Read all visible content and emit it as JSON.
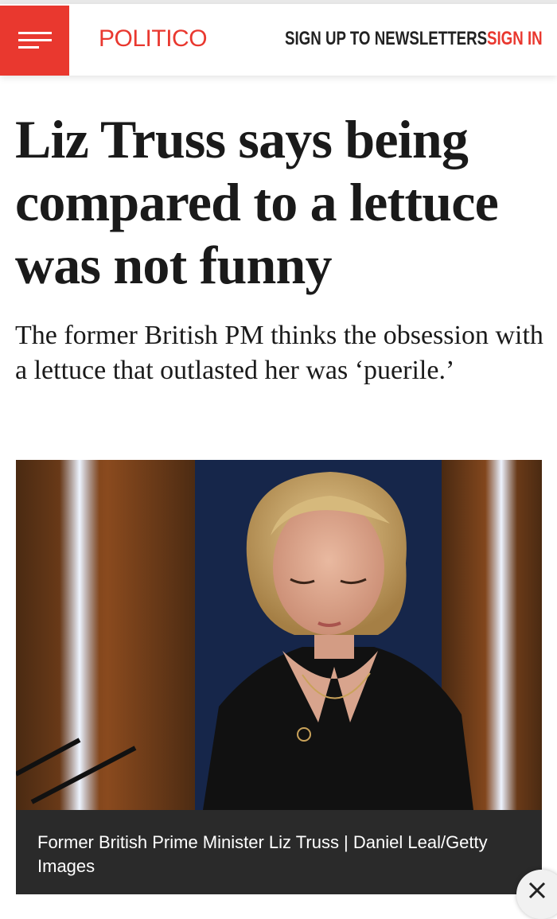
{
  "header": {
    "logo": "POLITICO",
    "newsletters_label": "SIGN UP TO NEWSLETTERS",
    "signin_label": "SIGN IN",
    "menu_icon": "hamburger-menu-icon"
  },
  "article": {
    "headline": "Liz Truss says being compared to a lettuce was not funny",
    "dek": "The former British PM thinks the obsession with a lettuce that outlasted her was ‘puerile.’",
    "caption": "Former British Prime Minister Liz Truss | Daniel Leal/Getty Images"
  },
  "overlay": {
    "close_icon": "close-icon"
  },
  "colors": {
    "brand_red": "#e9382f",
    "text_dark": "#1a1a1a",
    "caption_bg": "#2a2a2a"
  }
}
